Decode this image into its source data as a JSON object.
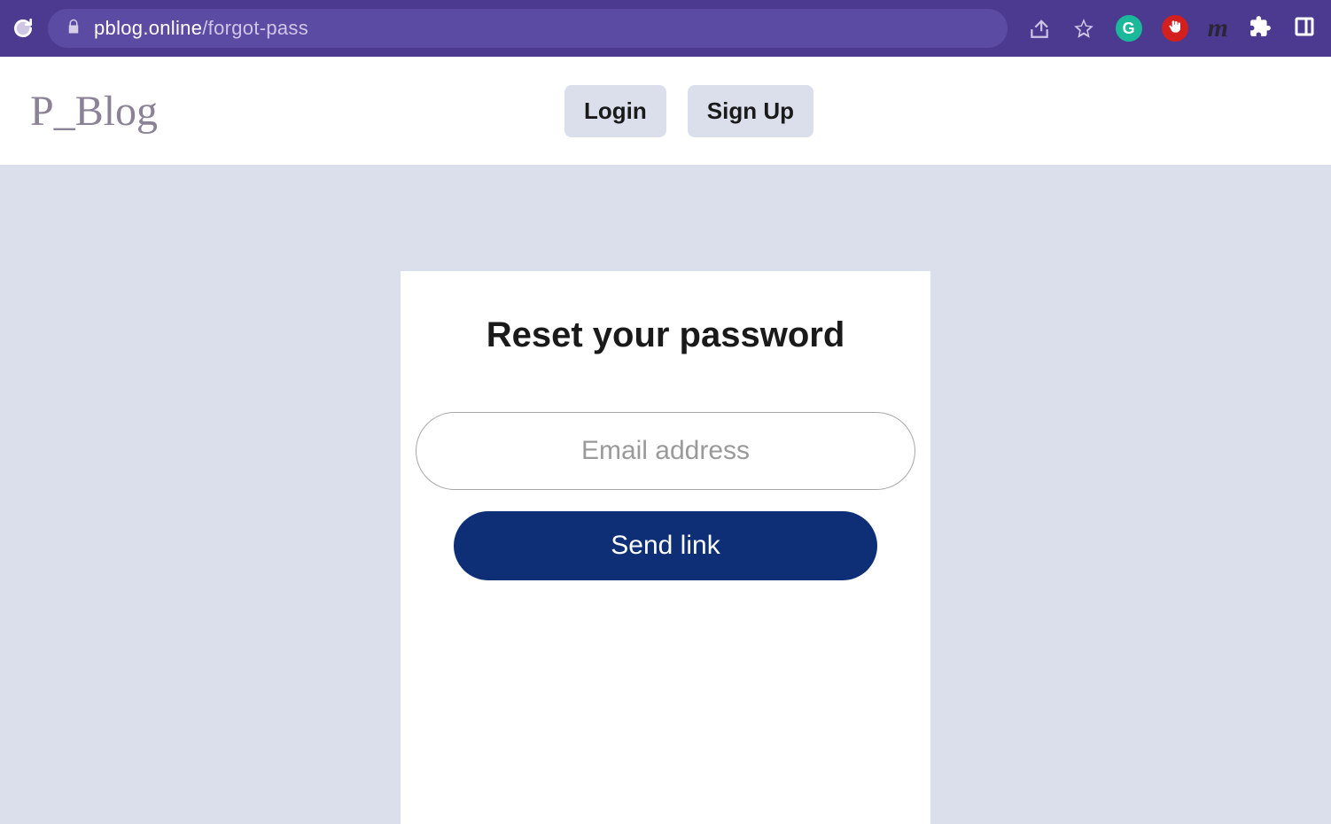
{
  "browser": {
    "url_domain": "pblog.online",
    "url_path": "/forgot-pass"
  },
  "header": {
    "logo": "P_Blog",
    "login_label": "Login",
    "signup_label": "Sign Up"
  },
  "card": {
    "title": "Reset your password",
    "email_placeholder": "Email address",
    "email_value": "",
    "send_label": "Send link"
  }
}
